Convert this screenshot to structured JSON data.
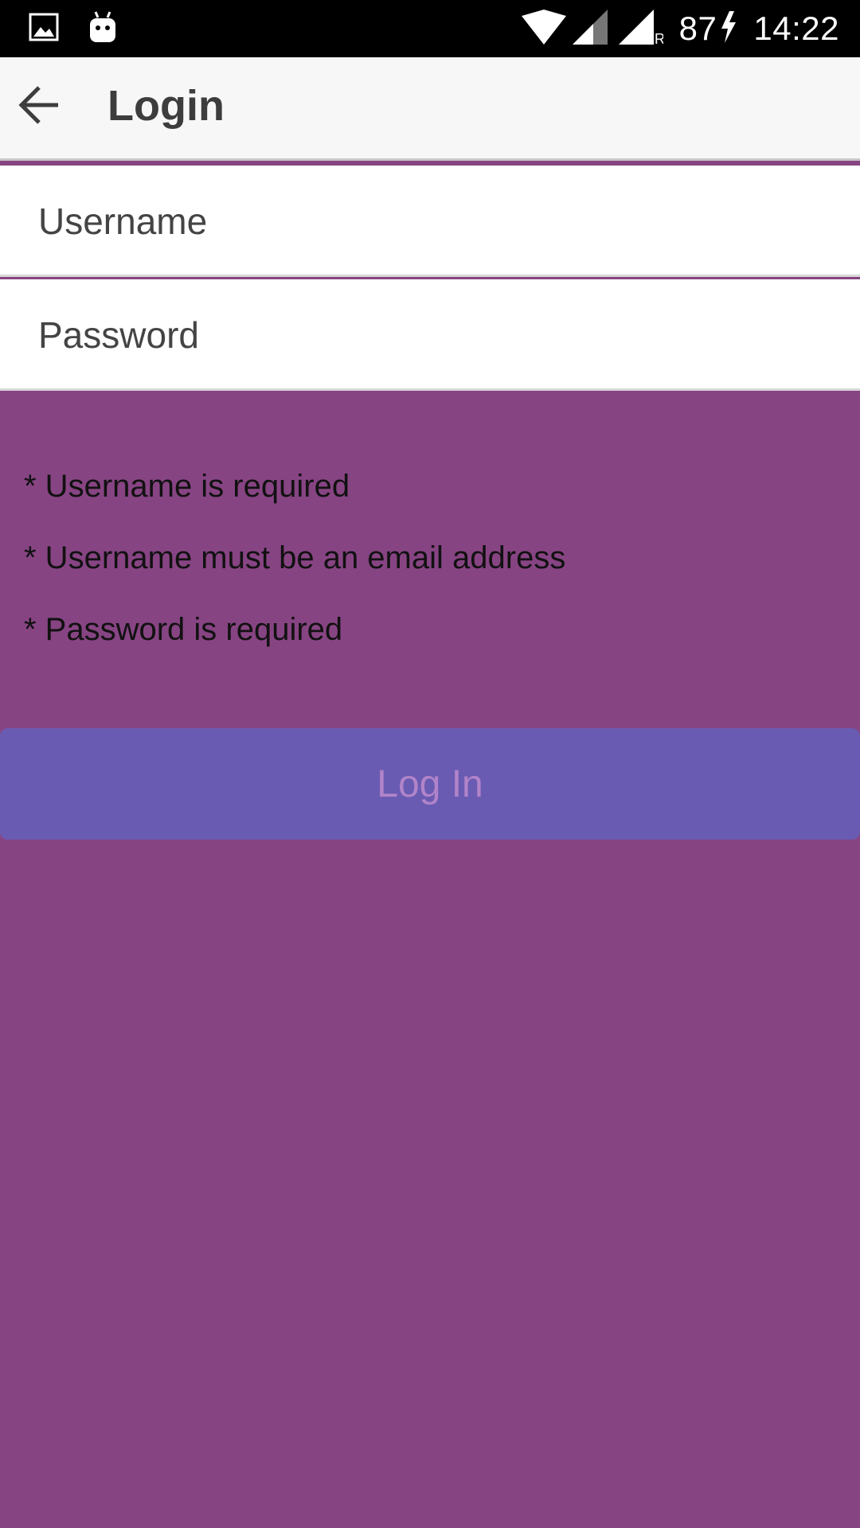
{
  "status_bar": {
    "battery": "87",
    "time": "14:22",
    "icons": [
      "image-icon",
      "android-icon",
      "wifi-icon",
      "signal-icon",
      "signal-roaming-icon",
      "charging-icon"
    ],
    "roaming_label": "R"
  },
  "app_bar": {
    "title": "Login",
    "back_icon": "arrow-left-icon"
  },
  "form": {
    "username": {
      "value": "",
      "placeholder": "Username"
    },
    "password": {
      "value": "",
      "placeholder": "Password"
    }
  },
  "errors": [
    "* Username is required",
    "* Username must be an email address",
    "* Password is required"
  ],
  "login_button": {
    "label": "Log In"
  },
  "colors": {
    "background": "#874483",
    "button": "#6a5bb2",
    "button_text": "#b184c9",
    "app_bar": "#f7f7f7"
  }
}
